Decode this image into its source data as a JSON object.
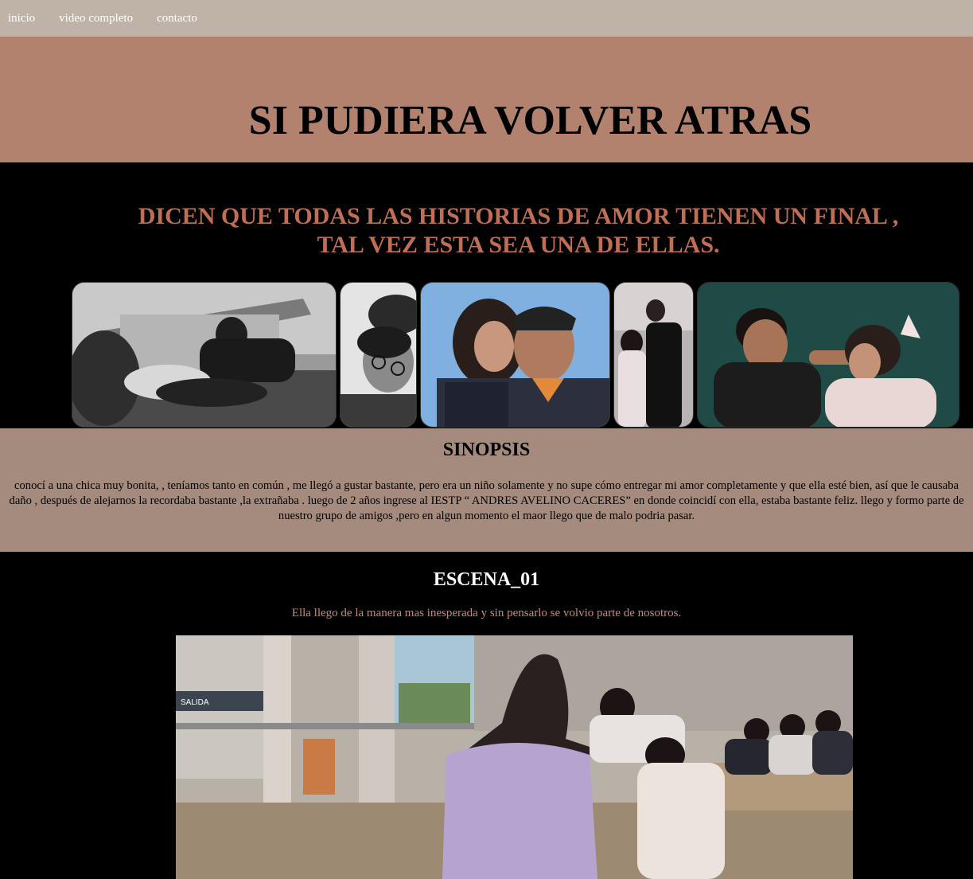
{
  "nav": {
    "items": [
      "inicio",
      "video completo",
      "contacto"
    ]
  },
  "hero": {
    "title": "SI PUDIERA VOLVER ATRAS"
  },
  "tagline": {
    "line1": "DICEN QUE TODAS LAS HISTORIAS DE AMOR TIENEN UN FINAL ,",
    "line2": "TAL VEZ ESTA SEA UNA DE ELLAS."
  },
  "synopsis": {
    "heading": "SINOPSIS",
    "text": "conocí a una chica muy bonita, , teníamos tanto en común , me llegó a gustar bastante, pero era un niño solamente y no supe cómo entregar mi amor completamente y que ella esté bien, así que le causaba daño , después de alejarnos la recordaba bastante ,la extrañaba . luego de 2 años ingrese al IESTP “ ANDRES AVELINO CACERES” en donde coincidí con ella, estaba bastante feliz. llego y formo parte de nuestro grupo de amigos ,pero en algun momento el maor llego que de malo podria pasar."
  },
  "scene": {
    "heading": "ESCENA_01",
    "caption": "Ella llego de la manera mas inesperada y sin pensarlo se volvio parte de nosotros.",
    "sign_text": "SALIDA"
  },
  "colors": {
    "nav_bg": "#bfb3a7",
    "hero_bg": "#b3826e",
    "tagline_text": "#c06f55",
    "synopsis_bg": "#a58b7e",
    "caption_text": "#c48a78"
  }
}
